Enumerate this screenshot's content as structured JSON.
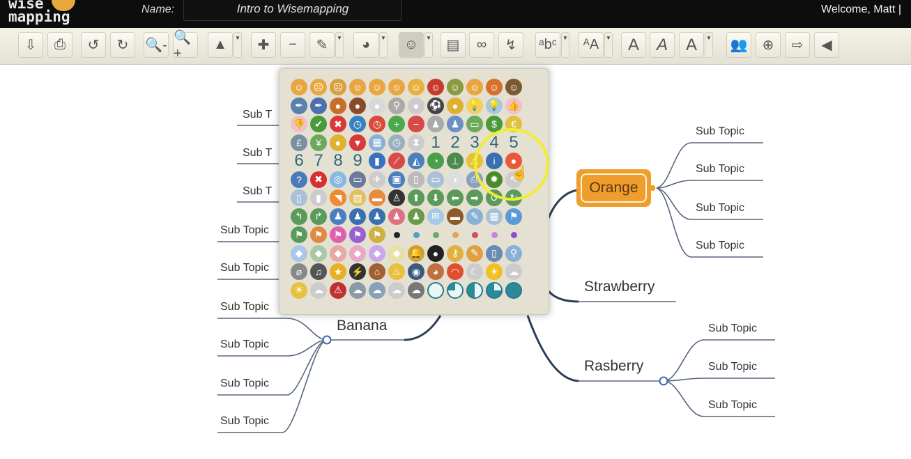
{
  "header": {
    "logo_text": "wise mapping",
    "name_label": "Name:",
    "map_name": "Intro to Wisemapping",
    "welcome": "Welcome, Matt |"
  },
  "toolbar": [
    {
      "n": "export-button",
      "g": "⇩"
    },
    {
      "n": "print-button",
      "g": "⎙"
    },
    {
      "n": "undo-button",
      "g": "↺"
    },
    {
      "n": "redo-button",
      "g": "↻"
    },
    {
      "n": "zoom-out-button",
      "g": "🔍-"
    },
    {
      "n": "zoom-in-button",
      "g": "🔍+"
    },
    {
      "n": "topic-shape-button",
      "g": "▲",
      "dd": true
    },
    {
      "n": "add-topic-button",
      "g": "✚"
    },
    {
      "n": "delete-topic-button",
      "g": "−"
    },
    {
      "n": "border-color-button",
      "g": "✎",
      "dd": true
    },
    {
      "n": "background-color-button",
      "g": "◕",
      "dd": true
    },
    {
      "n": "topic-icon-button",
      "g": "☺",
      "dd": true,
      "active": true
    },
    {
      "n": "topic-note-button",
      "g": "▤"
    },
    {
      "n": "topic-link-button",
      "g": "∞"
    },
    {
      "n": "relationship-button",
      "g": "↯"
    },
    {
      "n": "font-family-button",
      "g": "ᵃbᶜ",
      "dd": true
    },
    {
      "n": "font-size-button",
      "g": "ᴬA",
      "dd": true
    },
    {
      "n": "bold-button",
      "g": "A"
    },
    {
      "n": "italic-button",
      "g": "A"
    },
    {
      "n": "font-color-button",
      "g": "A",
      "dd": true
    },
    {
      "n": "share-button",
      "g": "👥"
    },
    {
      "n": "publish-button",
      "g": "⊕"
    },
    {
      "n": "history-button",
      "g": "⇨"
    },
    {
      "n": "back-button",
      "g": "◀"
    }
  ],
  "mindmap": {
    "central_topics": {
      "orange": "Orange",
      "strawberry": "Strawberry",
      "rasberry": "Rasberry",
      "banana": "Banana"
    },
    "orange_subtopics": [
      "Sub Topic",
      "Sub Topic",
      "Sub Topic",
      "Sub Topic"
    ],
    "rasberry_subtopics": [
      "Sub Topic",
      "Sub Topic",
      "Sub Topic"
    ],
    "banana_subtopics": [
      "Sub Topic",
      "Sub Topic",
      "Sub Topic",
      "Sub Topic"
    ],
    "left_subtopics": [
      "Sub Topic",
      "Sub Topic"
    ],
    "left_truncated_subtopics": [
      "Sub T",
      "Sub T",
      "Sub T"
    ],
    "colors": {
      "orange_node": "#ef9d2c",
      "connector": "#2c3e55"
    }
  },
  "icon_palette": {
    "rows": [
      [
        [
          "face-plain",
          "☺",
          "#e9a640"
        ],
        [
          "face-sad",
          "☹",
          "#e9a640"
        ],
        [
          "face-crying",
          "☹",
          "#d9a040"
        ],
        [
          "face-smile",
          "☺",
          "#e9a640"
        ],
        [
          "face-surprised",
          "☺",
          "#e9a640"
        ],
        [
          "face-wink",
          "☺",
          "#e9a640"
        ],
        [
          "face-grin",
          "☺",
          "#e9b040"
        ],
        [
          "face-devil",
          "☺",
          "#c83a2a"
        ],
        [
          "face-glasses",
          "☺",
          "#8a9a40"
        ],
        [
          "face-laugh",
          "☺",
          "#e9a640"
        ],
        [
          "face-shout",
          "☺",
          "#d9702a"
        ],
        [
          "face-monkey",
          "☺",
          "#7a5a30"
        ]
      ],
      [
        [
          "feather",
          "✒",
          "#5a80b0"
        ],
        [
          "pen",
          "✒",
          "#4a70b0"
        ],
        [
          "basketball",
          "●",
          "#c8702a"
        ],
        [
          "football",
          "●",
          "#8a4a2a"
        ],
        [
          "golfball",
          "●",
          "#d8d8d8"
        ],
        [
          "racket",
          "⚲",
          "#aaa"
        ],
        [
          "pingpong",
          "●",
          "#ccc"
        ],
        [
          "soccer-ball",
          "⚽",
          "#444"
        ],
        [
          "tennis-ball",
          "●",
          "#e0b030"
        ],
        [
          "bulb-on",
          "💡",
          "#f0d060"
        ],
        [
          "bulb-off",
          "💡",
          "#a8c8d8"
        ],
        [
          "thumb-up",
          "👍",
          "#f0c0c8"
        ]
      ],
      [
        [
          "thumb-down",
          "👎",
          "#f0c0c8"
        ],
        [
          "check",
          "✔",
          "#4a9a3a"
        ],
        [
          "cross",
          "✖",
          "#d83a3a"
        ],
        [
          "clock-blue",
          "◷",
          "#3a80c0"
        ],
        [
          "clock-red",
          "◷",
          "#d84a3a"
        ],
        [
          "add-green",
          "+",
          "#4aaa4a"
        ],
        [
          "minus-red",
          "−",
          "#d84a4a"
        ],
        [
          "user-gray",
          "♟",
          "#aaa"
        ],
        [
          "user-blue",
          "♟",
          "#6a90c8"
        ],
        [
          "money",
          "▭",
          "#6aaa5a"
        ],
        [
          "dollar",
          "$",
          "#4a9a3a"
        ],
        [
          "euro",
          "€",
          "#e0c040"
        ]
      ],
      [
        [
          "pound",
          "£",
          "#7a90a0"
        ],
        [
          "yen",
          "¥",
          "#6aaa5a"
        ],
        [
          "coins",
          "●",
          "#e0b030"
        ],
        [
          "ruby",
          "▼",
          "#d83a3a"
        ],
        [
          "calendar",
          "▦",
          "#8ab0d8"
        ],
        [
          "clock",
          "◷",
          "#9ab0c0"
        ],
        [
          "hourglass",
          "⧗",
          "#ccc"
        ],
        [
          "number-1",
          "1",
          ""
        ],
        [
          "number-2",
          "2",
          ""
        ],
        [
          "number-3",
          "3",
          ""
        ],
        [
          "number-4",
          "4",
          ""
        ],
        [
          "number-5",
          "5",
          ""
        ]
      ],
      [
        [
          "number-6",
          "6",
          ""
        ],
        [
          "number-7",
          "7",
          ""
        ],
        [
          "number-8",
          "8",
          ""
        ],
        [
          "number-9",
          "9",
          ""
        ],
        [
          "chart-bar",
          "▮",
          "#3a70c0"
        ],
        [
          "chart-line",
          "⟋",
          "#d84a4a"
        ],
        [
          "chart-area",
          "◭",
          "#4a80c0"
        ],
        [
          "chart-pie",
          "◔",
          "#4aa04a"
        ],
        [
          "org-chart",
          "⊥",
          "#4a8a4a"
        ],
        [
          "warning",
          "⚠",
          "#e8c030"
        ],
        [
          "info",
          "i",
          "#3a70b0"
        ],
        [
          "bullet-red",
          "●",
          "#e85a3a"
        ]
      ],
      [
        [
          "help",
          "?",
          "#4a7ab8"
        ],
        [
          "error",
          "✖",
          "#d83030"
        ],
        [
          "cd",
          "◎",
          "#8ab8e0"
        ],
        [
          "computer",
          "▭",
          "#6a7a9a"
        ],
        [
          "gamepad",
          "✈",
          "#ccc"
        ],
        [
          "floppy",
          "▣",
          "#4a80c0"
        ],
        [
          "ipod",
          "▯",
          "#bbb"
        ],
        [
          "keyboard",
          "▭",
          "#aac0d8"
        ],
        [
          "mouse",
          "◖",
          "#ddd"
        ],
        [
          "printer",
          "⎙",
          "#8aa0c0"
        ],
        [
          "bug",
          "✹",
          "#4a8a2a"
        ],
        [
          "cursor",
          "↖",
          "#ccc"
        ]
      ],
      [
        [
          "page",
          "▯",
          "#a8c0d8"
        ],
        [
          "database",
          "▮",
          "#ccc"
        ],
        [
          "rss",
          "◥",
          "#f08a30"
        ],
        [
          "image-edit",
          "▨",
          "#e0c060"
        ],
        [
          "note",
          "▬",
          "#e88a40"
        ],
        [
          "linux",
          "♙",
          "#333"
        ],
        [
          "arrow-up",
          "⬆",
          "#5a9a5a"
        ],
        [
          "arrow-down",
          "⬇",
          "#5a9a5a"
        ],
        [
          "arrow-left",
          "⬅",
          "#5a9a5a"
        ],
        [
          "arrow-right",
          "➡",
          "#5a9a5a"
        ],
        [
          "rotate-left",
          "↺",
          "#5a9a5a"
        ],
        [
          "rotate-right",
          "↻",
          "#5a9a5a"
        ]
      ],
      [
        [
          "turn-left",
          "↰",
          "#5a9a5a"
        ],
        [
          "turn-right",
          "↱",
          "#5a9a5a"
        ],
        [
          "users",
          "♟",
          "#4a80c0"
        ],
        [
          "user",
          "♟",
          "#3a70b0"
        ],
        [
          "user-male",
          "♟",
          "#3a70b0"
        ],
        [
          "user-female",
          "♟",
          "#e07080"
        ],
        [
          "user-green",
          "♟",
          "#6a9a4a"
        ],
        [
          "email",
          "✉",
          "#a8c8e8"
        ],
        [
          "briefcase",
          "▬",
          "#8a5a2a"
        ],
        [
          "page-edit",
          "✎",
          "#8ab0d8"
        ],
        [
          "table",
          "▦",
          "#a8c0d8"
        ],
        [
          "flag-blue",
          "⚑",
          "#5a9ad8"
        ]
      ],
      [
        [
          "flag-green",
          "⚑",
          "#5a9a5a"
        ],
        [
          "flag-orange",
          "⚑",
          "#e08a40"
        ],
        [
          "flag-pink",
          "⚑",
          "#e060b0"
        ],
        [
          "flag-purple",
          "⚑",
          "#9a60d0"
        ],
        [
          "flag-yellow",
          "⚑",
          "#d0b040"
        ],
        [
          "dot-black",
          "",
          "#222"
        ],
        [
          "dot-blue",
          "",
          "#4aa0d0"
        ],
        [
          "dot-green",
          "",
          "#6aaa6a"
        ],
        [
          "dot-orange",
          "",
          "#e8a050"
        ],
        [
          "dot-red",
          "",
          "#d84a5a"
        ],
        [
          "dot-pink",
          "",
          "#d080e0"
        ],
        [
          "dot-purple",
          "",
          "#8a50d0"
        ]
      ],
      [
        [
          "tag-blue",
          "◆",
          "#a8c8e8"
        ],
        [
          "tag-green",
          "◆",
          "#a8c8a8"
        ],
        [
          "tag-red",
          "◆",
          "#e8a8a8"
        ],
        [
          "tag-pink",
          "◆",
          "#e8a8c8"
        ],
        [
          "tag-purple",
          "◆",
          "#c8a8e8"
        ],
        [
          "tag-yellow",
          "◆",
          "#e8e0a8"
        ],
        [
          "bell",
          "🔔",
          "#d0a030"
        ],
        [
          "bomb",
          "●",
          "#222"
        ],
        [
          "key",
          "⚷",
          "#e0b040"
        ],
        [
          "pencil",
          "✎",
          "#e0a040"
        ],
        [
          "phone",
          "▯",
          "#6a8ab0"
        ],
        [
          "magnifier",
          "⚲",
          "#8ab0d8"
        ]
      ],
      [
        [
          "paperclip",
          "⌀",
          "#888"
        ],
        [
          "music",
          "♫",
          "#555"
        ],
        [
          "star",
          "★",
          "#e8b020"
        ],
        [
          "magic-wand",
          "⚡",
          "#333"
        ],
        [
          "house",
          "⌂",
          "#a06030"
        ],
        [
          "cake",
          "♨",
          "#e8c040"
        ],
        [
          "camera",
          "◉",
          "#3a5a80"
        ],
        [
          "palette",
          "◕",
          "#c07040"
        ],
        [
          "rainbow",
          "◠",
          "#e05030"
        ],
        [
          "moon",
          "☾",
          "#ccc"
        ],
        [
          "sun",
          "☀",
          "#f0c020"
        ],
        [
          "cloud",
          "☁",
          "#ccc"
        ]
      ],
      [
        [
          "weather-sun-cloud",
          "☀",
          "#e8c040"
        ],
        [
          "weather-clouds",
          "☁",
          "#ccc"
        ],
        [
          "weather-warning",
          "⚠",
          "#c03030"
        ],
        [
          "weather-storm",
          "☁",
          "#8a9aa8"
        ],
        [
          "weather-rain",
          "☁",
          "#8aa0b8"
        ],
        [
          "weather-snow",
          "☁",
          "#ccc"
        ],
        [
          "weather-lightning",
          "☁",
          "#777"
        ],
        [
          "progress-0",
          "",
          "#e0f4f4"
        ],
        [
          "progress-25",
          "",
          "#2a8a9a"
        ],
        [
          "progress-50",
          "",
          "#2a8a9a"
        ],
        [
          "progress-75",
          "",
          "#2a8a9a"
        ],
        [
          "progress-100",
          "",
          "#2a8a9a"
        ]
      ]
    ]
  }
}
